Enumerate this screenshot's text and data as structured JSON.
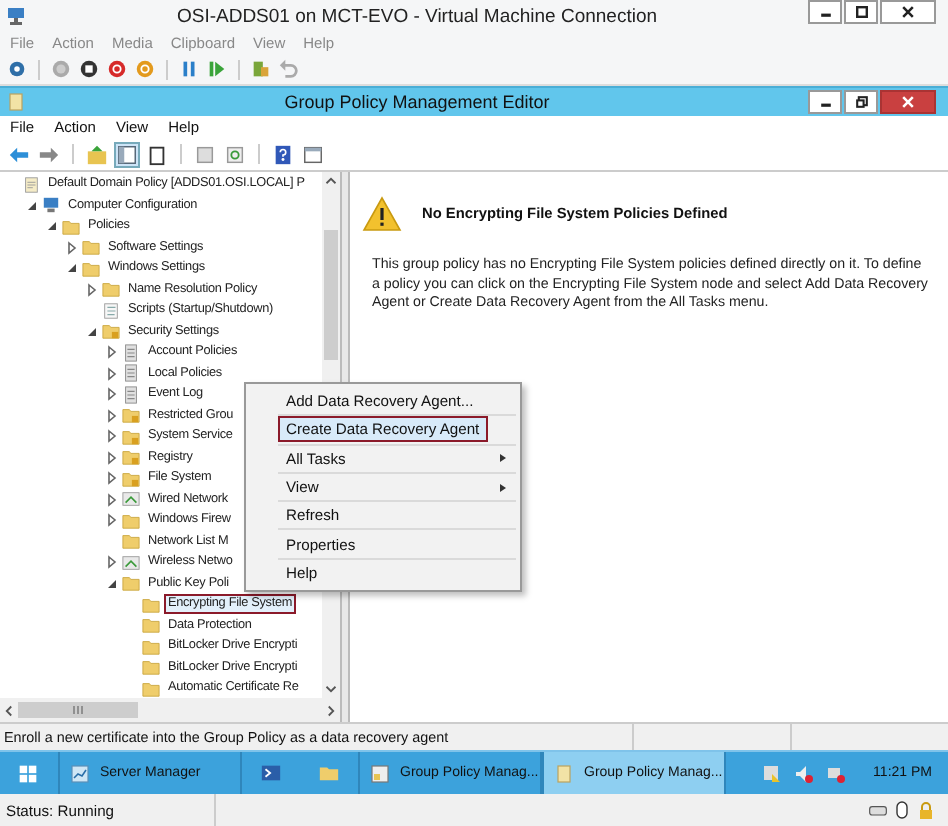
{
  "vm_window": {
    "title": "OSI-ADDS01 on MCT-EVO - Virtual Machine Connection",
    "menu": [
      "File",
      "Action",
      "Media",
      "Clipboard",
      "View",
      "Help"
    ]
  },
  "editor": {
    "title": "Group Policy Management Editor",
    "menu": [
      "File",
      "Action",
      "View",
      "Help"
    ],
    "tree": [
      {
        "label": "Default Domain Policy [ADDS01.OSI.LOCAL] P",
        "kind": "policy",
        "selected": false,
        "children": [
          {
            "label": "Computer Configuration",
            "kind": "computer",
            "expanded": true,
            "selected": false,
            "children": [
              {
                "label": "Policies",
                "kind": "folder",
                "expanded": true,
                "selected": false,
                "children": [
                  {
                    "label": "Software Settings",
                    "kind": "folder",
                    "expanded": false,
                    "selected": false
                  },
                  {
                    "label": "Windows Settings",
                    "kind": "folder",
                    "expanded": true,
                    "selected": false,
                    "children": [
                      {
                        "label": "Name Resolution Policy",
                        "kind": "folder",
                        "expanded": false,
                        "selected": false
                      },
                      {
                        "label": "Scripts (Startup/Shutdown)",
                        "kind": "script",
                        "selected": false
                      },
                      {
                        "label": "Security Settings",
                        "kind": "locked-folder",
                        "expanded": true,
                        "selected": false,
                        "children": [
                          {
                            "label": "Account Policies",
                            "kind": "sheet",
                            "expanded": false,
                            "selected": false
                          },
                          {
                            "label": "Local Policies",
                            "kind": "sheet",
                            "expanded": false,
                            "selected": false
                          },
                          {
                            "label": "Event Log",
                            "kind": "sheet",
                            "expanded": false,
                            "selected": false
                          },
                          {
                            "label": "Restricted Grou",
                            "kind": "locked-folder",
                            "expanded": false,
                            "selected": false
                          },
                          {
                            "label": "System Service",
                            "kind": "locked-folder",
                            "expanded": false,
                            "selected": false
                          },
                          {
                            "label": "Registry",
                            "kind": "locked-folder",
                            "expanded": false,
                            "selected": false
                          },
                          {
                            "label": "File System",
                            "kind": "locked-folder",
                            "expanded": false,
                            "selected": false
                          },
                          {
                            "label": "Wired Network",
                            "kind": "network",
                            "expanded": false,
                            "selected": false
                          },
                          {
                            "label": "Windows Firew",
                            "kind": "folder",
                            "expanded": false,
                            "selected": false
                          },
                          {
                            "label": "Network List M",
                            "kind": "folder",
                            "selected": false
                          },
                          {
                            "label": "Wireless Netwo",
                            "kind": "network",
                            "expanded": false,
                            "selected": false
                          },
                          {
                            "label": "Public Key Poli",
                            "kind": "folder",
                            "expanded": true,
                            "selected": false,
                            "children": [
                              {
                                "label": "Encrypting File System",
                                "kind": "folder",
                                "selected": true,
                                "annotated": true
                              },
                              {
                                "label": "Data Protection",
                                "kind": "folder",
                                "selected": false
                              },
                              {
                                "label": "BitLocker Drive Encrypti",
                                "kind": "folder",
                                "selected": false
                              },
                              {
                                "label": "BitLocker Drive Encrypti",
                                "kind": "folder",
                                "selected": false
                              },
                              {
                                "label": "Automatic Certificate Re",
                                "kind": "folder",
                                "selected": false
                              }
                            ]
                          }
                        ]
                      }
                    ]
                  }
                ]
              }
            ]
          }
        ]
      }
    ],
    "details": {
      "heading": "No Encrypting File System Policies Defined",
      "body": "This group policy has no Encrypting File System policies defined directly on it.  To define a policy you can click on the Encrypting File System node and select Add Data Recovery Agent or Create Data Recovery Agent from the All Tasks menu."
    },
    "context_menu": [
      {
        "label": "Add Data Recovery Agent...",
        "selected": false,
        "submenu": false
      },
      {
        "label": "Create Data Recovery Agent",
        "selected": true,
        "annotated": true,
        "submenu": false
      },
      {
        "label": "All Tasks",
        "selected": false,
        "submenu": true
      },
      {
        "label": "View",
        "selected": false,
        "submenu": true
      },
      {
        "label": "Refresh",
        "selected": false,
        "submenu": false
      },
      {
        "label": "Properties",
        "selected": false,
        "submenu": false
      },
      {
        "label": "Help",
        "selected": false,
        "submenu": false
      }
    ],
    "status_text": "Enroll a new certificate into the Group Policy as a data recovery agent"
  },
  "taskbar": {
    "buttons": [
      {
        "label": "Server Manager",
        "kind": "server",
        "selected": false
      },
      {
        "label": "Group Policy Manag...",
        "kind": "gpm",
        "selected": false
      },
      {
        "label": "Group Policy Manag...",
        "kind": "editor",
        "selected": true
      }
    ],
    "clock": "11:21 PM"
  },
  "status_bar": {
    "text": "Status: Running"
  }
}
